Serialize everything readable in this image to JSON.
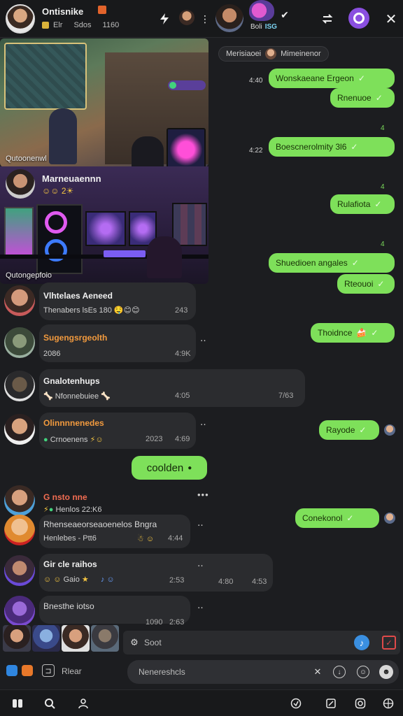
{
  "header": {
    "title": "Ontisnike",
    "sub_label1": "Elr",
    "sub_label2": "Sdos",
    "sub_count": "1160",
    "contact2_name": "Boli",
    "contact2_tag": "ISG"
  },
  "media": {
    "caption1": "Qutoonenwl",
    "title2": "Marneuaennn",
    "emoji2": "☺☺ 2☀",
    "caption2": "Qutongepfoio"
  },
  "mention": {
    "label": "Merisiaoei",
    "name": "Mimeinenor"
  },
  "left_messages": [
    {
      "name": "Vlhtelaes Aeneed",
      "text": "Thenabers lsEs 180",
      "emoji": "🤤😊😊",
      "time": "243"
    },
    {
      "name": "Sugengsrgeolth",
      "text": "2086",
      "time": "4:9K"
    },
    {
      "name": "Gnalotenhups",
      "text": "Nfonnebuiee",
      "time1": "4:05",
      "time2": "7/63"
    },
    {
      "name": "Olinnnnenedes",
      "text": "Crnoenens",
      "time1": "2023",
      "time2": "4:69"
    },
    {
      "name": "G nsto nne",
      "text": "Henlos 22:K6"
    },
    {
      "name": "Rhenseaeorseaoenelos Bngra",
      "text": "Henlebes - Ptt6",
      "time": "4:44"
    },
    {
      "name": "Gir cle raihos",
      "text": "Gaio",
      "time1": "2:53",
      "time2": "4:80",
      "time3": "4:53"
    },
    {
      "name": "Bnesthe iotso",
      "time1": "1090",
      "time2": "2:63"
    }
  ],
  "right_messages": [
    {
      "text": "Wonskaeane Ergeon",
      "time": "4:40"
    },
    {
      "text": "Rnenuoe"
    },
    {
      "text": "Boescnerolmity 3l6",
      "time": "4:22",
      "mark": "4"
    },
    {
      "text": "Rulafiota",
      "mark": "4"
    },
    {
      "text": "Shuedioen angales",
      "mark": "4"
    },
    {
      "text": "Rteouoi"
    },
    {
      "text": "Thoidnce"
    },
    {
      "text": "Rayode"
    },
    {
      "text": "Conekonol"
    }
  ],
  "center_bubble": {
    "text": "coolden"
  },
  "composer": {
    "left_label": "Rlear",
    "search_text": "Soot",
    "input_placeholder": "Nenereshcls"
  },
  "colors": {
    "accent_green": "#7ee05a",
    "accent_violet": "#8a4fe0",
    "background": "#1c1d20"
  }
}
